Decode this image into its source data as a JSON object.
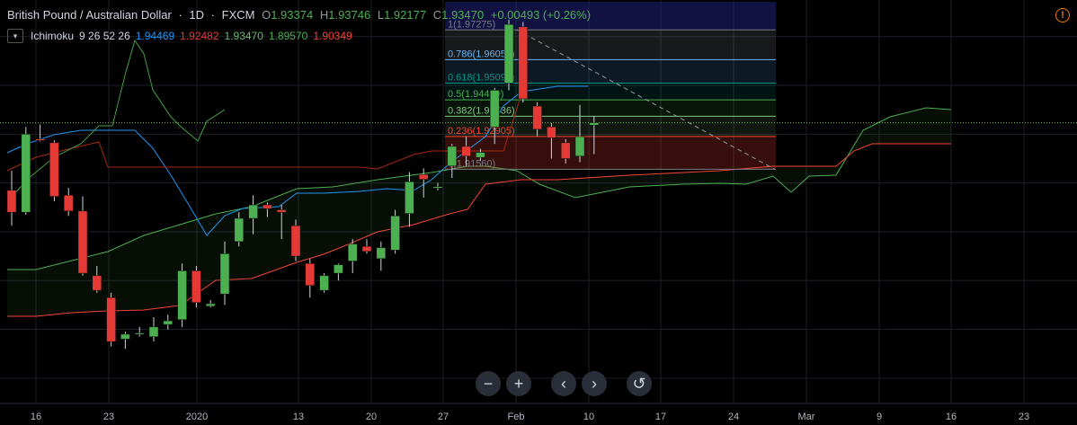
{
  "header": {
    "symbol": "British Pound / Australian Dollar",
    "sep1": "·",
    "interval": "1D",
    "sep2": "·",
    "source": "FXCM",
    "o_key": "O",
    "o_val": "1.93374",
    "h_key": "H",
    "h_val": "1.93746",
    "l_key": "L",
    "l_val": "1.92177",
    "c_key": "C",
    "c_val": "1.93470",
    "change": "+0.00493 (+0.26%)"
  },
  "indicator": {
    "toggle_icon": "chevron-down-icon",
    "name": "Ichimoku",
    "params": "9 26 52 26",
    "v1": "1.94469",
    "v2": "1.92482",
    "v3": "1.93470",
    "v4": "1.89570",
    "v5": "1.90349"
  },
  "colors": {
    "up": "#4caf50",
    "down": "#e53935",
    "conversion": "#2196f3",
    "base": "#a52714",
    "lagging": "#43a047",
    "spanA": "#4caf50",
    "spanB": "#f44336",
    "fib_level_0": "#787b86",
    "fib_level_0236": "#f44336",
    "fib_level_0382": "#81c784",
    "fib_level_05": "#4caf50",
    "fib_level_0618": "#009688",
    "fib_level_0786": "#64b5f6",
    "fib_level_1": "#787b86",
    "alert": "#f57c00"
  },
  "nav_buttons": [
    {
      "name": "zoom-out-icon",
      "glyph": "−"
    },
    {
      "name": "zoom-in-icon",
      "glyph": "+"
    },
    {
      "name": "scroll-left-icon",
      "glyph": "‹"
    },
    {
      "name": "scroll-right-icon",
      "glyph": "›"
    },
    {
      "name": "reset-icon",
      "glyph": "↺"
    }
  ],
  "alert_icon": "alert-icon",
  "chart_data": {
    "type": "candlestick",
    "x_ticks": [
      "16",
      "23",
      "2020",
      "13",
      "20",
      "27",
      "Feb",
      "10",
      "17",
      "24",
      "Mar",
      "9",
      "16",
      "23"
    ],
    "candles": [
      {
        "o": 1.907,
        "h": 1.915,
        "l": 1.8925,
        "c": 1.898
      },
      {
        "o": 1.898,
        "h": 1.933,
        "l": 1.897,
        "c": 1.93
      },
      {
        "o": 1.928,
        "h": 1.934,
        "l": 1.927,
        "c": 1.9275
      },
      {
        "o": 1.9265,
        "h": 1.9275,
        "l": 1.9025,
        "c": 1.9045
      },
      {
        "o": 1.905,
        "h": 1.908,
        "l": 1.8965,
        "c": 1.8985
      },
      {
        "o": 1.8985,
        "h": 1.9045,
        "l": 1.872,
        "c": 1.873
      },
      {
        "o": 1.872,
        "h": 1.876,
        "l": 1.865,
        "c": 1.866
      },
      {
        "o": 1.863,
        "h": 1.865,
        "l": 1.843,
        "c": 1.845
      },
      {
        "o": 1.846,
        "h": 1.849,
        "l": 1.842,
        "c": 1.848
      },
      {
        "o": 1.848,
        "h": 1.851,
        "l": 1.847,
        "c": 1.8485
      },
      {
        "o": 1.847,
        "h": 1.855,
        "l": 1.845,
        "c": 1.851
      },
      {
        "o": 1.852,
        "h": 1.856,
        "l": 1.85,
        "c": 1.8535
      },
      {
        "o": 1.854,
        "h": 1.877,
        "l": 1.851,
        "c": 1.874
      },
      {
        "o": 1.874,
        "h": 1.876,
        "l": 1.859,
        "c": 1.861
      },
      {
        "o": 1.8595,
        "h": 1.862,
        "l": 1.859,
        "c": 1.8605
      },
      {
        "o": 1.8645,
        "h": 1.886,
        "l": 1.86,
        "c": 1.881
      },
      {
        "o": 1.886,
        "h": 1.898,
        "l": 1.884,
        "c": 1.8955
      },
      {
        "o": 1.8955,
        "h": 1.905,
        "l": 1.889,
        "c": 1.901
      },
      {
        "o": 1.901,
        "h": 1.902,
        "l": 1.896,
        "c": 1.8995
      },
      {
        "o": 1.899,
        "h": 1.901,
        "l": 1.887,
        "c": 1.898
      },
      {
        "o": 1.8925,
        "h": 1.895,
        "l": 1.878,
        "c": 1.88
      },
      {
        "o": 1.877,
        "h": 1.879,
        "l": 1.863,
        "c": 1.868
      },
      {
        "o": 1.866,
        "h": 1.873,
        "l": 1.865,
        "c": 1.872
      },
      {
        "o": 1.873,
        "h": 1.877,
        "l": 1.87,
        "c": 1.8765
      },
      {
        "o": 1.878,
        "h": 1.887,
        "l": 1.873,
        "c": 1.885
      },
      {
        "o": 1.884,
        "h": 1.887,
        "l": 1.881,
        "c": 1.882
      },
      {
        "o": 1.879,
        "h": 1.886,
        "l": 1.874,
        "c": 1.8835
      },
      {
        "o": 1.8825,
        "h": 1.899,
        "l": 1.881,
        "c": 1.8965
      },
      {
        "o": 1.8975,
        "h": 1.9145,
        "l": 1.892,
        "c": 1.9105
      },
      {
        "o": 1.9135,
        "h": 1.916,
        "l": 1.904,
        "c": 1.9115
      },
      {
        "o": 1.908,
        "h": 1.91,
        "l": 1.907,
        "c": 1.9085
      },
      {
        "o": 1.917,
        "h": 1.926,
        "l": 1.912,
        "c": 1.925
      },
      {
        "o": 1.925,
        "h": 1.929,
        "l": 1.917,
        "c": 1.921
      },
      {
        "o": 1.9205,
        "h": 1.924,
        "l": 1.919,
        "c": 1.9225
      },
      {
        "o": 1.933,
        "h": 1.949,
        "l": 1.926,
        "c": 1.948
      },
      {
        "o": 1.951,
        "h": 1.977,
        "l": 1.948,
        "c": 1.975
      },
      {
        "o": 1.974,
        "h": 1.976,
        "l": 1.943,
        "c": 1.9445
      },
      {
        "o": 1.9415,
        "h": 1.943,
        "l": 1.929,
        "c": 1.932
      },
      {
        "o": 1.933,
        "h": 1.9345,
        "l": 1.92,
        "c": 1.9285
      },
      {
        "o": 1.9265,
        "h": 1.928,
        "l": 1.918,
        "c": 1.92
      },
      {
        "o": 1.921,
        "h": 1.942,
        "l": 1.9185,
        "c": 1.929
      },
      {
        "o": 1.9337,
        "h": 1.9375,
        "l": 1.9218,
        "c": 1.9347
      }
    ],
    "fibonacci": {
      "levels": [
        {
          "ratio": "0",
          "label": "0(1.91560)"
        },
        {
          "ratio": "0.236",
          "label": "0.236(1.92905)"
        },
        {
          "ratio": "0.382",
          "label": "0.382(1.93736)"
        },
        {
          "ratio": "0.5",
          "label": "0.5(1.94409)"
        },
        {
          "ratio": "0.618",
          "label": "0.618(1.95094)"
        },
        {
          "ratio": "0.786",
          "label": "0.786(1.96055)"
        },
        {
          "ratio": "1",
          "label": "1(1.97275)"
        }
      ]
    },
    "ylim": [
      1.82,
      1.985
    ],
    "current_price": 1.9347
  }
}
